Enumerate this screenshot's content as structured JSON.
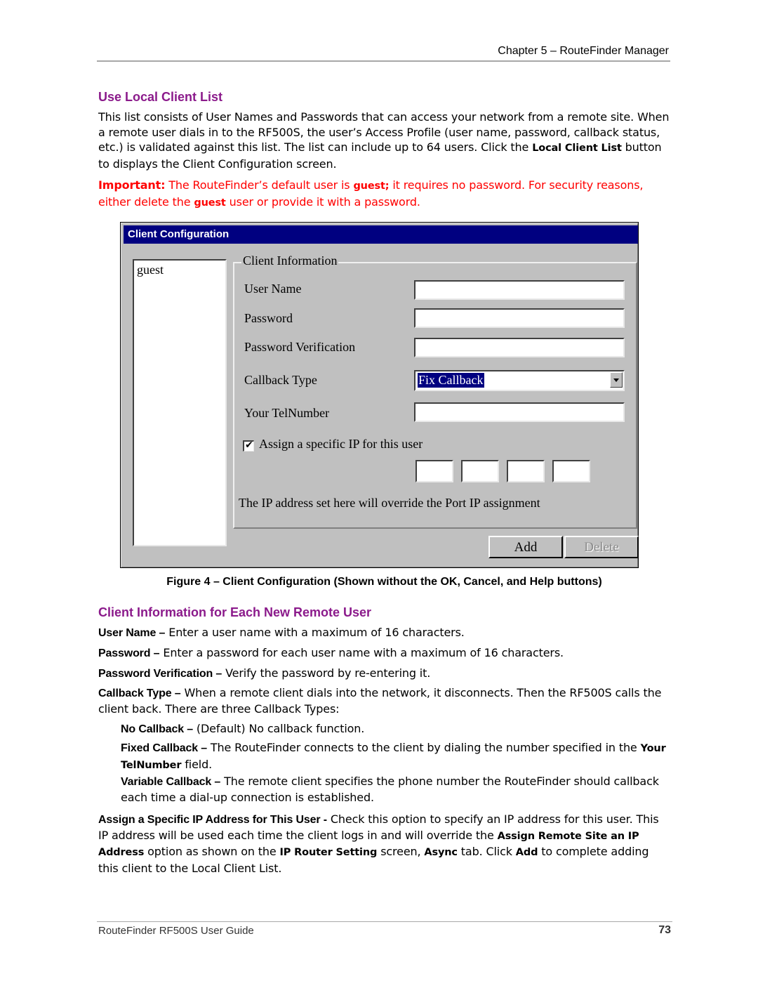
{
  "header": {
    "chapter": "Chapter 5 – RouteFinder Manager"
  },
  "section1": {
    "title": "Use Local Client List",
    "para": {
      "t1": "This list consists of User Names and Passwords that can access your network from a remote site. When a remote user dials in to the RF500S, the user’s Access Profile (user name, password, callback status, etc.) is validated against this list. The list can include up to 64 users. Click the ",
      "b1": "Local Client List",
      "t2": " button to displays the Client Configuration screen."
    },
    "important": {
      "label": "Important:",
      "t1": " The RouteFinder’s default user is ",
      "b1": "guest;",
      "t2": " it requires no password.  For security reasons, either delete the ",
      "b2": "guest",
      "t3": " user or provide it with a password."
    }
  },
  "dialog": {
    "title": "Client Configuration",
    "client_list": [
      "guest"
    ],
    "group_title": "Client Information",
    "fields": {
      "user_name": {
        "label": "User Name",
        "value": ""
      },
      "password": {
        "label": "Password",
        "value": ""
      },
      "password_verification": {
        "label": "Password Verification",
        "value": ""
      },
      "callback_type": {
        "label": "Callback Type",
        "value": "Fix Callback"
      },
      "tel_number": {
        "label": "Your TelNumber",
        "value": ""
      }
    },
    "assign_ip": {
      "label": "Assign a specific IP for this user",
      "checked": true,
      "checkmark": "✔"
    },
    "ip_octets": [
      "",
      "",
      "",
      ""
    ],
    "note": "The IP address set here will override the Port IP assignment",
    "buttons": {
      "add": "Add",
      "delete": "Delete"
    }
  },
  "figure_caption": "Figure 4 – Client Configuration (Shown without the OK, Cancel, and Help buttons)",
  "section2": {
    "title": "Client Information for Each New Remote User",
    "items": {
      "user_name": {
        "term": "User Name –",
        "desc": " Enter a user name with a maximum of 16 characters."
      },
      "password": {
        "term": "Password –",
        "desc": " Enter a password for each user name with a maximum of 16 characters."
      },
      "password_verification": {
        "term": "Password Verification –",
        "desc": " Verify the password by re-entering it."
      },
      "callback_type": {
        "term": "Callback Type –",
        "desc": " When a remote client dials into the network, it disconnects. Then the RF500S calls the client back. There are three Callback Types:"
      },
      "no_callback": {
        "term": "No Callback –",
        "desc": " (Default) No callback function."
      },
      "fixed_callback": {
        "term": "Fixed Callback –",
        "desc1": " The RouteFinder connects to the client by dialing the number specified in the ",
        "b1": "Your TelNumber",
        "desc2": " field."
      },
      "variable_callback": {
        "term": "Variable Callback –",
        "desc": " The remote client specifies the phone number the RouteFinder should callback each time a dial-up connection is established."
      },
      "assign_ip": {
        "term": "Assign a Specific IP Address for This User -",
        "desc1": " Check this option to specify an IP address for this user. This IP address will be used each time the client logs in and will override the ",
        "b1": "Assign Remote Site an IP Address",
        "desc2": " option as shown on the ",
        "b2": "IP Router Setting",
        "desc3": " screen, ",
        "b3": "Async",
        "desc4": " tab. Click ",
        "b4": "Add",
        "desc5": " to complete adding this client to the Local Client List."
      }
    }
  },
  "footer": {
    "guide": "RouteFinder RF500S User Guide",
    "page": "73"
  },
  "colors": {
    "heading": "#8b1a8b",
    "important": "#ff0000",
    "titlebar": "#000080",
    "dialog_bg": "#c0c0c0"
  }
}
